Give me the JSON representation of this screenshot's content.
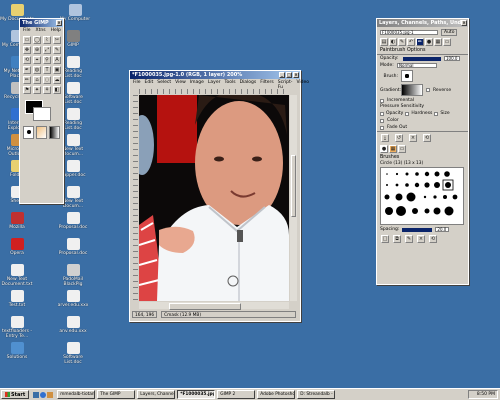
{
  "desktop": {
    "icons": [
      {
        "label": "My Documents",
        "color": "#e8d070"
      },
      {
        "label": "My Computer",
        "color": "#b0c4de"
      },
      {
        "label": "My Network Places",
        "color": "#4080c0"
      },
      {
        "label": "Recycle Bin",
        "color": "#c0c0c0"
      },
      {
        "label": "Internet Explorer",
        "color": "#3070d0"
      },
      {
        "label": "Microsoft Outlook",
        "color": "#d09040"
      },
      {
        "label": "Folder",
        "color": "#e8d070"
      },
      {
        "label": "Sheet",
        "color": "#f0f0f0"
      },
      {
        "label": "Mozilla",
        "color": "#c03030"
      },
      {
        "label": "Opera",
        "color": "#d02020"
      },
      {
        "label": "New Text Document.txt",
        "color": "#f0f0f0"
      },
      {
        "label": "Test.txt",
        "color": "#f0f0f0"
      },
      {
        "label": "textfloaders - Entry Te...",
        "color": "#f0f0f0"
      },
      {
        "label": "Solutions",
        "color": "#5090d0"
      }
    ],
    "icons_col2": [
      {
        "label": "GIMP",
        "color": "#808080"
      },
      {
        "label": "Reading List.doc",
        "color": "#f0f0f0"
      },
      {
        "label": "Software List.doc",
        "color": "#f0f0f0"
      },
      {
        "label": "Reading List.doc",
        "color": "#f0f0f0"
      },
      {
        "label": "New Text Docum...",
        "color": "#f0f0f0"
      },
      {
        "label": "Zapper.doc",
        "color": "#f0f0f0"
      },
      {
        "label": "New Text Docum...",
        "color": "#f0f0f0"
      },
      {
        "label": "Proposal.doc",
        "color": "#f0f0f0"
      },
      {
        "label": "Proposal.doc",
        "color": "#f0f0f0"
      },
      {
        "label": "PadoMail BlackPig",
        "color": "#d0d0d0"
      },
      {
        "label": "arver.edu.xxx",
        "color": "#f0f0f0"
      },
      {
        "label": "anv.edu.xxx",
        "color": "#f0f0f0"
      },
      {
        "label": "Software List.doc",
        "color": "#f0f0f0"
      }
    ],
    "icons_col3": [
      {
        "label": "My Computer",
        "color": "#b0c4de"
      }
    ]
  },
  "toolbox": {
    "title": "The GIMP",
    "menu": [
      "File",
      "Xtns",
      "Help"
    ],
    "tools": [
      "▭",
      "◯",
      "⌇",
      "✂",
      "✥",
      "⊕",
      "⤢",
      "✎",
      "⟲",
      "⌖",
      "⚲",
      "A",
      "✒",
      "◍",
      "T",
      "▣",
      "✏",
      "⌂",
      "◌",
      "☁",
      "⚑",
      "✦",
      "⚘",
      "◧"
    ]
  },
  "image_window": {
    "title": "*F1000035.jpg-1.0 (RGB, 1 layer) 200%",
    "menu": [
      "File",
      "Edit",
      "Select",
      "View",
      "Image",
      "Layer",
      "Tools",
      "Dialogs",
      "Filters",
      "Script-Fu",
      "Video"
    ],
    "status_left": "164, 196",
    "status_right": "Cmask (12.9 MB)"
  },
  "layers_dialog": {
    "title": "Layers, Channels, Paths, Undo",
    "image_select": "F1000035.jpg-1",
    "auto_label": "Auto",
    "section_title": "Paintbrush Options",
    "opacity_label": "Opacity:",
    "opacity_value": "100.0",
    "mode_label": "Mode:",
    "mode_value": "Normal",
    "brush_label": "Brush:",
    "gradient_label": "Gradient:",
    "reverse_label": "Reverse",
    "incremental_label": "Incremental",
    "pressure_label": "Pressure Sensitivity",
    "pressure_opacity": "Opacity",
    "pressure_hardness": "Hardness",
    "pressure_size": "Size",
    "color_label": "Color",
    "fade_label": "Fade Out",
    "brushes_title": "Brushes",
    "brush_name": "Circle (13) (13 x 13)",
    "spacing_label": "Spacing:",
    "spacing_value": "20.0"
  },
  "taskbar": {
    "start_label": "Start",
    "tasks": [
      "mmedalb-tiotani",
      "The GIMP",
      "Layers, Channel...",
      "*F1000035.jpg",
      "GIMP 2",
      "Adobe Photoshop",
      "D: Streandalb - Te..."
    ],
    "active_task_index": 3,
    "clock": "8:50 PM"
  }
}
